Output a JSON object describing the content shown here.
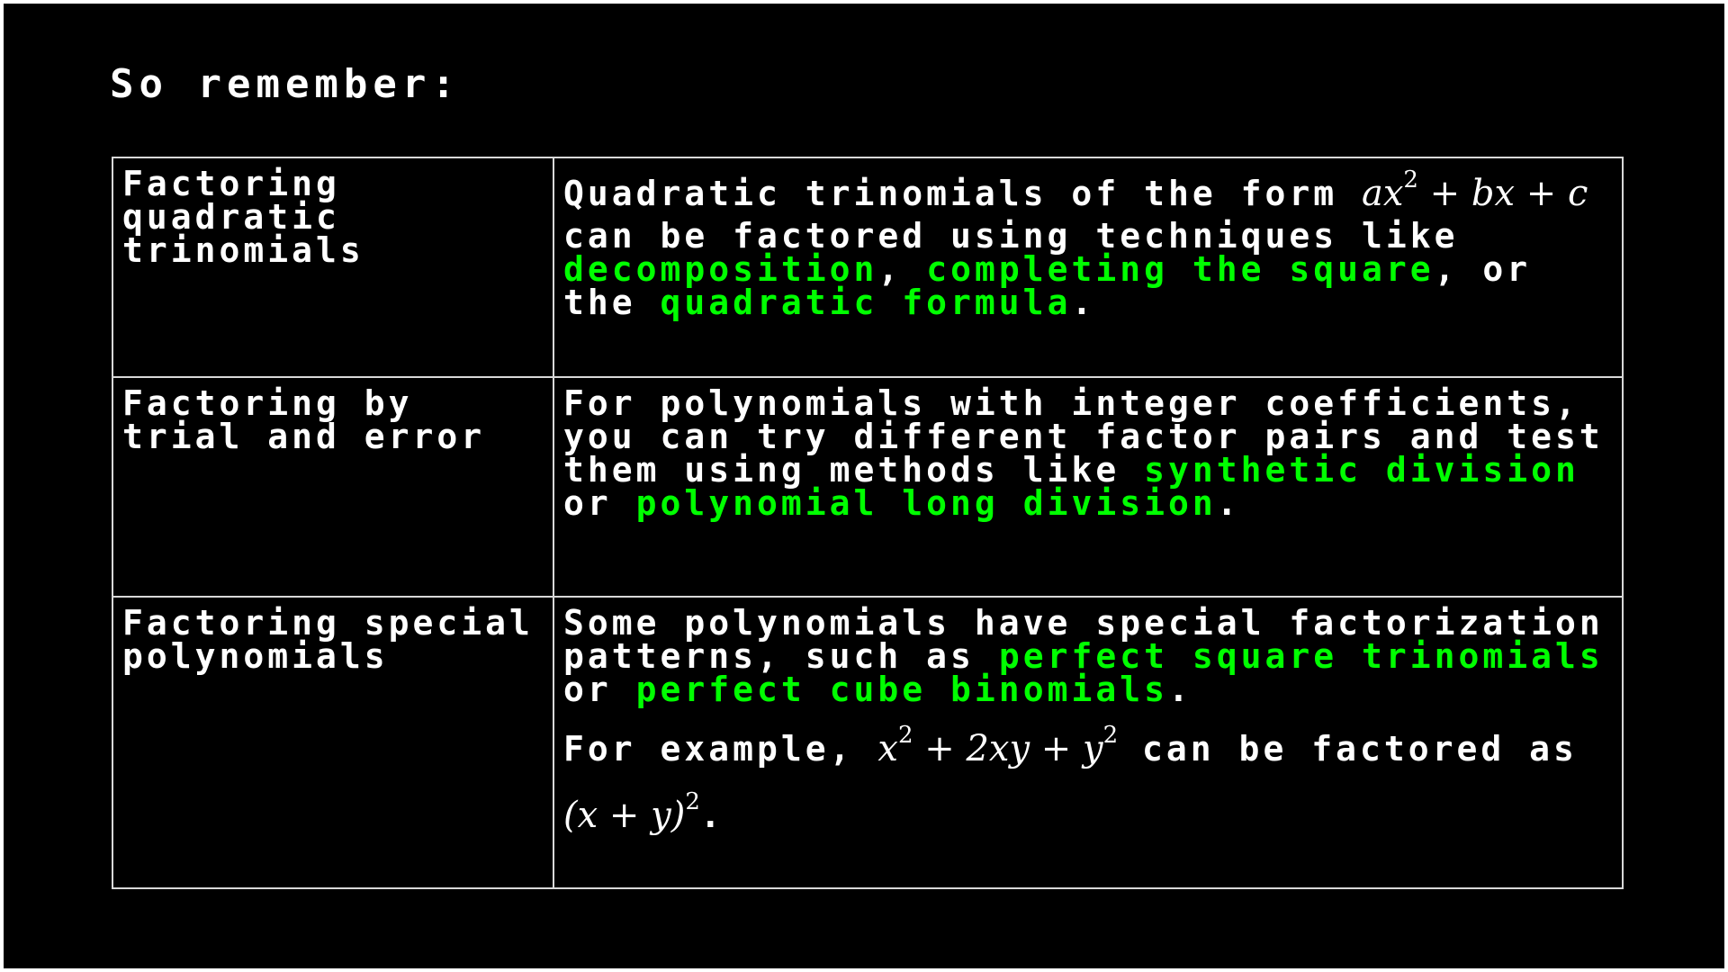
{
  "title": "So remember:",
  "rows": [
    {
      "topic": "Factoring quadratic trinomials",
      "desc": {
        "t1": "Quadratic trinomials of the form ",
        "math_a": "ax",
        "math_a_exp": "2",
        "math_b": " + bx + c",
        "t2": " can be factored using techniques like ",
        "hl1": "decomposition",
        "t3": ", ",
        "hl2": "completing the square",
        "t4": ", or the ",
        "hl3": "quadratic formula",
        "t5": "."
      }
    },
    {
      "topic": "Factoring by trial and error",
      "desc": {
        "t1": "For polynomials with integer coefficients, you can try different factor pairs and test them using methods like ",
        "hl1": "synthetic division",
        "t2": " or ",
        "hl2": "polynomial long division",
        "t3": "."
      }
    },
    {
      "topic": "Factoring special polynomials",
      "desc": {
        "t1": "Some polynomials have special factorization patterns, such as ",
        "hl1": "perfect square trinomials",
        "t2": " or ",
        "hl2": "perfect cube binomials",
        "t3": ".",
        "ex_intro": "For example, ",
        "ex_x": "x",
        "ex_x_exp": "2",
        "ex_mid": " + 2xy + y",
        "ex_y_exp": "2",
        "ex_t1": " can be factored as ",
        "ex_fact": "(x + y)",
        "ex_fact_exp": "2",
        "ex_end": "."
      }
    }
  ]
}
